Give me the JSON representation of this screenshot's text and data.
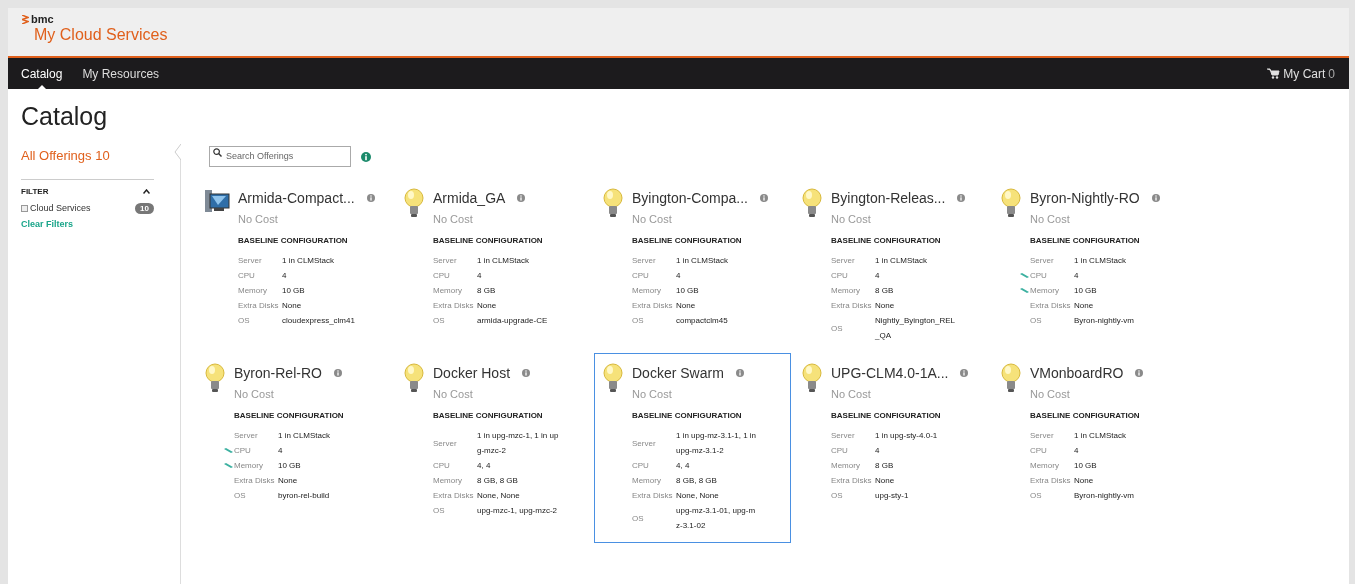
{
  "brand": {
    "logo": "bmc",
    "title": "My Cloud Services"
  },
  "nav": {
    "tabs": [
      {
        "label": "Catalog",
        "selected": true
      },
      {
        "label": "My Resources",
        "selected": false
      }
    ],
    "cart": {
      "label": "My Cart",
      "count": "0"
    }
  },
  "page_title": "Catalog",
  "sidebar": {
    "all_offerings": "All Offerings 10",
    "filter_title": "FILTER",
    "filters": [
      {
        "label": "Cloud Services",
        "checked": false,
        "count": "10"
      }
    ],
    "clear": "Clear Filters"
  },
  "search": {
    "placeholder": "Search Offerings"
  },
  "offerings": [
    {
      "name": "Armida-Compact...",
      "kind": "monitor",
      "selected": false,
      "cost": "No Cost",
      "heading": "BASELINE CONFIGURATION",
      "rows": [
        {
          "label": "Server",
          "value": "1 in CLMStack",
          "modified": false
        },
        {
          "label": "CPU",
          "value": "4",
          "modified": false
        },
        {
          "label": "Memory",
          "value": "10 GB",
          "modified": false
        },
        {
          "label": "Extra Disks",
          "value": "None",
          "modified": false
        },
        {
          "label": "OS",
          "value": "cloudexpress_clm41",
          "modified": false
        }
      ]
    },
    {
      "name": "Armida_GA",
      "kind": "bulb",
      "selected": false,
      "cost": "No Cost",
      "heading": "BASELINE CONFIGURATION",
      "rows": [
        {
          "label": "Server",
          "value": "1 in CLMStack",
          "modified": false
        },
        {
          "label": "CPU",
          "value": "4",
          "modified": false
        },
        {
          "label": "Memory",
          "value": "8 GB",
          "modified": false
        },
        {
          "label": "Extra Disks",
          "value": "None",
          "modified": false
        },
        {
          "label": "OS",
          "value": "armida-upgrade-CE",
          "modified": false
        }
      ]
    },
    {
      "name": "Byington-Compa...",
      "kind": "bulb",
      "selected": false,
      "cost": "No Cost",
      "heading": "BASELINE CONFIGURATION",
      "rows": [
        {
          "label": "Server",
          "value": "1 in CLMStack",
          "modified": false
        },
        {
          "label": "CPU",
          "value": "4",
          "modified": false
        },
        {
          "label": "Memory",
          "value": "10 GB",
          "modified": false
        },
        {
          "label": "Extra Disks",
          "value": "None",
          "modified": false
        },
        {
          "label": "OS",
          "value": "compactclm45",
          "modified": false
        }
      ]
    },
    {
      "name": "Byington-Releas...",
      "kind": "bulb",
      "selected": false,
      "cost": "No Cost",
      "heading": "BASELINE CONFIGURATION",
      "rows": [
        {
          "label": "Server",
          "value": "1 in CLMStack",
          "modified": false
        },
        {
          "label": "CPU",
          "value": "4",
          "modified": false
        },
        {
          "label": "Memory",
          "value": "8 GB",
          "modified": false
        },
        {
          "label": "Extra Disks",
          "value": "None",
          "modified": false
        },
        {
          "label": "OS",
          "value": "Nightly_Byington_REL_QA",
          "modified": false
        }
      ]
    },
    {
      "name": "Byron-Nightly-RO",
      "kind": "bulb",
      "selected": false,
      "cost": "No Cost",
      "heading": "BASELINE CONFIGURATION",
      "rows": [
        {
          "label": "Server",
          "value": "1 in CLMStack",
          "modified": false
        },
        {
          "label": "CPU",
          "value": "4",
          "modified": true
        },
        {
          "label": "Memory",
          "value": "10 GB",
          "modified": true
        },
        {
          "label": "Extra Disks",
          "value": "None",
          "modified": false
        },
        {
          "label": "OS",
          "value": "Byron-nightly-vm",
          "modified": false
        }
      ]
    },
    {
      "name": "Byron-Rel-RO",
      "kind": "bulb",
      "selected": false,
      "cost": "No Cost",
      "heading": "BASELINE CONFIGURATION",
      "rows": [
        {
          "label": "Server",
          "value": "1 in CLMStack",
          "modified": false
        },
        {
          "label": "CPU",
          "value": "4",
          "modified": true
        },
        {
          "label": "Memory",
          "value": "10 GB",
          "modified": true
        },
        {
          "label": "Extra Disks",
          "value": "None",
          "modified": false
        },
        {
          "label": "OS",
          "value": "byron-rel-build",
          "modified": false
        }
      ]
    },
    {
      "name": "Docker Host",
      "kind": "bulb",
      "selected": false,
      "cost": "No Cost",
      "heading": "BASELINE CONFIGURATION",
      "rows": [
        {
          "label": "Server",
          "value": "1 in upg-mzc-1, 1 in upg-mzc-2",
          "modified": false
        },
        {
          "label": "CPU",
          "value": "4, 4",
          "modified": false
        },
        {
          "label": "Memory",
          "value": "8 GB, 8 GB",
          "modified": false
        },
        {
          "label": "Extra Disks",
          "value": "None, None",
          "modified": false
        },
        {
          "label": "OS",
          "value": "upg-mzc-1, upg-mzc-2",
          "modified": false
        }
      ]
    },
    {
      "name": "Docker Swarm",
      "kind": "bulb",
      "selected": true,
      "cost": "No Cost",
      "heading": "BASELINE CONFIGURATION",
      "rows": [
        {
          "label": "Server",
          "value": "1 in upg-mz-3.1-1, 1 in upg-mz-3.1-2",
          "modified": false
        },
        {
          "label": "CPU",
          "value": "4, 4",
          "modified": false
        },
        {
          "label": "Memory",
          "value": "8 GB, 8 GB",
          "modified": false
        },
        {
          "label": "Extra Disks",
          "value": "None, None",
          "modified": false
        },
        {
          "label": "OS",
          "value": "upg-mz-3.1-01, upg-mz-3.1-02",
          "modified": false
        }
      ]
    },
    {
      "name": "UPG-CLM4.0-1A...",
      "kind": "bulb",
      "selected": false,
      "cost": "No Cost",
      "heading": "BASELINE CONFIGURATION",
      "rows": [
        {
          "label": "Server",
          "value": "1 in upg-sty-4.0-1",
          "modified": false
        },
        {
          "label": "CPU",
          "value": "4",
          "modified": false
        },
        {
          "label": "Memory",
          "value": "8 GB",
          "modified": false
        },
        {
          "label": "Extra Disks",
          "value": "None",
          "modified": false
        },
        {
          "label": "OS",
          "value": "upg-sty-1",
          "modified": false
        }
      ]
    },
    {
      "name": "VMonboardRO",
      "kind": "bulb",
      "selected": false,
      "cost": "No Cost",
      "heading": "BASELINE CONFIGURATION",
      "rows": [
        {
          "label": "Server",
          "value": "1 in CLMStack",
          "modified": false
        },
        {
          "label": "CPU",
          "value": "4",
          "modified": false
        },
        {
          "label": "Memory",
          "value": "10 GB",
          "modified": false
        },
        {
          "label": "Extra Disks",
          "value": "None",
          "modified": false
        },
        {
          "label": "OS",
          "value": "Byron-nightly-vm",
          "modified": false
        }
      ]
    }
  ]
}
